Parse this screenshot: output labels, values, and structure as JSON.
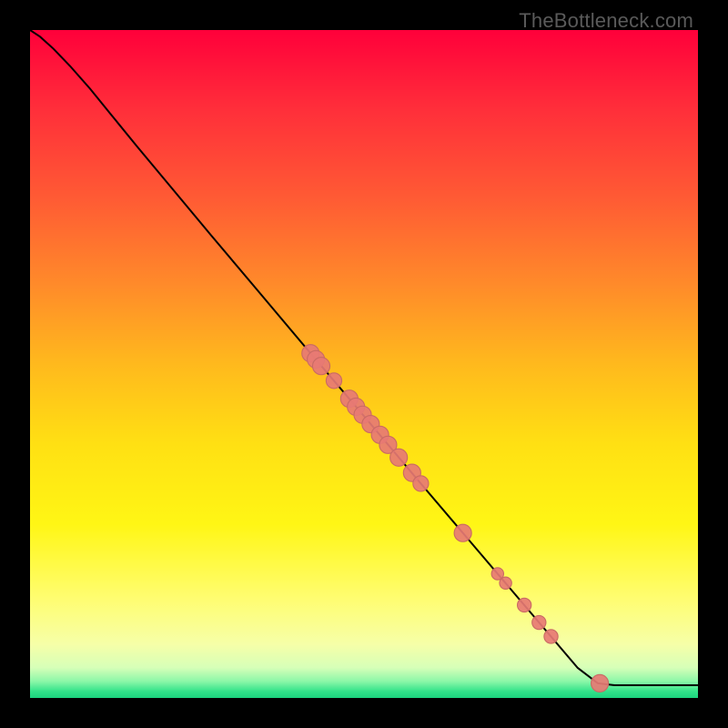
{
  "watermark": "TheBottleneck.com",
  "colors": {
    "bg_black": "#000000",
    "curve": "#000000",
    "point_fill": "#e77a74",
    "point_stroke": "#c96a64"
  },
  "chart_data": {
    "type": "line",
    "title": "",
    "xlabel": "",
    "ylabel": "",
    "xlim": [
      0,
      100
    ],
    "ylim": [
      0,
      100
    ],
    "gradient_stops": [
      {
        "offset": 0.0,
        "color": "#ff003a"
      },
      {
        "offset": 0.12,
        "color": "#ff2f3a"
      },
      {
        "offset": 0.25,
        "color": "#ff5a34"
      },
      {
        "offset": 0.38,
        "color": "#ff8a2a"
      },
      {
        "offset": 0.5,
        "color": "#ffb91d"
      },
      {
        "offset": 0.62,
        "color": "#ffe013"
      },
      {
        "offset": 0.74,
        "color": "#fff615"
      },
      {
        "offset": 0.85,
        "color": "#fffd70"
      },
      {
        "offset": 0.92,
        "color": "#f6ffa8"
      },
      {
        "offset": 0.955,
        "color": "#d6ffb8"
      },
      {
        "offset": 0.975,
        "color": "#8cf7a8"
      },
      {
        "offset": 0.99,
        "color": "#32e38a"
      },
      {
        "offset": 1.0,
        "color": "#1bd37e"
      }
    ],
    "curve_points": [
      {
        "x": 0.0,
        "y": 100.0
      },
      {
        "x": 1.5,
        "y": 99.0
      },
      {
        "x": 3.5,
        "y": 97.2
      },
      {
        "x": 6.0,
        "y": 94.6
      },
      {
        "x": 9.0,
        "y": 91.2
      },
      {
        "x": 12.0,
        "y": 87.5
      },
      {
        "x": 16.0,
        "y": 82.6
      },
      {
        "x": 21.0,
        "y": 76.6
      },
      {
        "x": 27.0,
        "y": 69.4
      },
      {
        "x": 34.0,
        "y": 61.1
      },
      {
        "x": 42.0,
        "y": 51.6
      },
      {
        "x": 50.0,
        "y": 42.2
      },
      {
        "x": 58.0,
        "y": 32.7
      },
      {
        "x": 66.0,
        "y": 23.3
      },
      {
        "x": 74.0,
        "y": 13.9
      },
      {
        "x": 82.0,
        "y": 4.5
      },
      {
        "x": 85.0,
        "y": 2.2
      },
      {
        "x": 87.5,
        "y": 1.9
      },
      {
        "x": 100.0,
        "y": 1.9
      }
    ],
    "points": [
      {
        "x": 42.0,
        "y": 51.6,
        "r": 1.0
      },
      {
        "x": 42.8,
        "y": 50.7,
        "r": 1.0
      },
      {
        "x": 43.6,
        "y": 49.7,
        "r": 1.0
      },
      {
        "x": 45.5,
        "y": 47.5,
        "r": 0.9
      },
      {
        "x": 47.8,
        "y": 44.8,
        "r": 1.0
      },
      {
        "x": 48.8,
        "y": 43.6,
        "r": 1.0
      },
      {
        "x": 49.8,
        "y": 42.4,
        "r": 1.0
      },
      {
        "x": 51.0,
        "y": 41.0,
        "r": 1.0
      },
      {
        "x": 52.4,
        "y": 39.4,
        "r": 1.0
      },
      {
        "x": 53.6,
        "y": 37.9,
        "r": 1.0
      },
      {
        "x": 55.2,
        "y": 36.0,
        "r": 1.0
      },
      {
        "x": 57.2,
        "y": 33.7,
        "r": 1.0
      },
      {
        "x": 58.5,
        "y": 32.1,
        "r": 0.9
      },
      {
        "x": 64.8,
        "y": 24.7,
        "r": 1.0
      },
      {
        "x": 70.0,
        "y": 18.6,
        "r": 0.7
      },
      {
        "x": 71.2,
        "y": 17.2,
        "r": 0.7
      },
      {
        "x": 74.0,
        "y": 13.9,
        "r": 0.8
      },
      {
        "x": 76.2,
        "y": 11.3,
        "r": 0.8
      },
      {
        "x": 78.0,
        "y": 9.2,
        "r": 0.8
      },
      {
        "x": 85.3,
        "y": 2.2,
        "r": 1.0
      }
    ]
  }
}
